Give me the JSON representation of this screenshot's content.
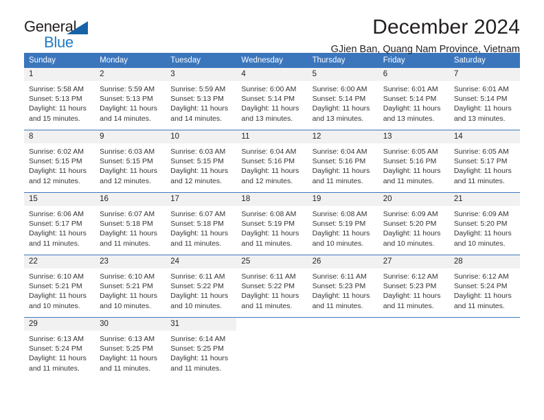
{
  "brand": {
    "name_part1": "General",
    "name_part2": "Blue",
    "triangle_icon": "blue-triangle-logo-mark"
  },
  "header": {
    "title": "December 2024",
    "subtitle": "GJien Ban, Quang Nam Province, Vietnam"
  },
  "colors": {
    "header_blue": "#3b76bd",
    "brand_blue": "#1f7ac4",
    "triangle_blue": "#1763a8",
    "daynum_band": "#f1f1f1",
    "text": "#231f20"
  },
  "calendar": {
    "weekday_headers": [
      "Sunday",
      "Monday",
      "Tuesday",
      "Wednesday",
      "Thursday",
      "Friday",
      "Saturday"
    ],
    "weeks": [
      [
        {
          "day": "1",
          "sunrise": "Sunrise: 5:58 AM",
          "sunset": "Sunset: 5:13 PM",
          "daylight": "Daylight: 11 hours and 15 minutes."
        },
        {
          "day": "2",
          "sunrise": "Sunrise: 5:59 AM",
          "sunset": "Sunset: 5:13 PM",
          "daylight": "Daylight: 11 hours and 14 minutes."
        },
        {
          "day": "3",
          "sunrise": "Sunrise: 5:59 AM",
          "sunset": "Sunset: 5:13 PM",
          "daylight": "Daylight: 11 hours and 14 minutes."
        },
        {
          "day": "4",
          "sunrise": "Sunrise: 6:00 AM",
          "sunset": "Sunset: 5:14 PM",
          "daylight": "Daylight: 11 hours and 13 minutes."
        },
        {
          "day": "5",
          "sunrise": "Sunrise: 6:00 AM",
          "sunset": "Sunset: 5:14 PM",
          "daylight": "Daylight: 11 hours and 13 minutes."
        },
        {
          "day": "6",
          "sunrise": "Sunrise: 6:01 AM",
          "sunset": "Sunset: 5:14 PM",
          "daylight": "Daylight: 11 hours and 13 minutes."
        },
        {
          "day": "7",
          "sunrise": "Sunrise: 6:01 AM",
          "sunset": "Sunset: 5:14 PM",
          "daylight": "Daylight: 11 hours and 13 minutes."
        }
      ],
      [
        {
          "day": "8",
          "sunrise": "Sunrise: 6:02 AM",
          "sunset": "Sunset: 5:15 PM",
          "daylight": "Daylight: 11 hours and 12 minutes."
        },
        {
          "day": "9",
          "sunrise": "Sunrise: 6:03 AM",
          "sunset": "Sunset: 5:15 PM",
          "daylight": "Daylight: 11 hours and 12 minutes."
        },
        {
          "day": "10",
          "sunrise": "Sunrise: 6:03 AM",
          "sunset": "Sunset: 5:15 PM",
          "daylight": "Daylight: 11 hours and 12 minutes."
        },
        {
          "day": "11",
          "sunrise": "Sunrise: 6:04 AM",
          "sunset": "Sunset: 5:16 PM",
          "daylight": "Daylight: 11 hours and 12 minutes."
        },
        {
          "day": "12",
          "sunrise": "Sunrise: 6:04 AM",
          "sunset": "Sunset: 5:16 PM",
          "daylight": "Daylight: 11 hours and 11 minutes."
        },
        {
          "day": "13",
          "sunrise": "Sunrise: 6:05 AM",
          "sunset": "Sunset: 5:16 PM",
          "daylight": "Daylight: 11 hours and 11 minutes."
        },
        {
          "day": "14",
          "sunrise": "Sunrise: 6:05 AM",
          "sunset": "Sunset: 5:17 PM",
          "daylight": "Daylight: 11 hours and 11 minutes."
        }
      ],
      [
        {
          "day": "15",
          "sunrise": "Sunrise: 6:06 AM",
          "sunset": "Sunset: 5:17 PM",
          "daylight": "Daylight: 11 hours and 11 minutes."
        },
        {
          "day": "16",
          "sunrise": "Sunrise: 6:07 AM",
          "sunset": "Sunset: 5:18 PM",
          "daylight": "Daylight: 11 hours and 11 minutes."
        },
        {
          "day": "17",
          "sunrise": "Sunrise: 6:07 AM",
          "sunset": "Sunset: 5:18 PM",
          "daylight": "Daylight: 11 hours and 11 minutes."
        },
        {
          "day": "18",
          "sunrise": "Sunrise: 6:08 AM",
          "sunset": "Sunset: 5:19 PM",
          "daylight": "Daylight: 11 hours and 11 minutes."
        },
        {
          "day": "19",
          "sunrise": "Sunrise: 6:08 AM",
          "sunset": "Sunset: 5:19 PM",
          "daylight": "Daylight: 11 hours and 10 minutes."
        },
        {
          "day": "20",
          "sunrise": "Sunrise: 6:09 AM",
          "sunset": "Sunset: 5:20 PM",
          "daylight": "Daylight: 11 hours and 10 minutes."
        },
        {
          "day": "21",
          "sunrise": "Sunrise: 6:09 AM",
          "sunset": "Sunset: 5:20 PM",
          "daylight": "Daylight: 11 hours and 10 minutes."
        }
      ],
      [
        {
          "day": "22",
          "sunrise": "Sunrise: 6:10 AM",
          "sunset": "Sunset: 5:21 PM",
          "daylight": "Daylight: 11 hours and 10 minutes."
        },
        {
          "day": "23",
          "sunrise": "Sunrise: 6:10 AM",
          "sunset": "Sunset: 5:21 PM",
          "daylight": "Daylight: 11 hours and 10 minutes."
        },
        {
          "day": "24",
          "sunrise": "Sunrise: 6:11 AM",
          "sunset": "Sunset: 5:22 PM",
          "daylight": "Daylight: 11 hours and 10 minutes."
        },
        {
          "day": "25",
          "sunrise": "Sunrise: 6:11 AM",
          "sunset": "Sunset: 5:22 PM",
          "daylight": "Daylight: 11 hours and 11 minutes."
        },
        {
          "day": "26",
          "sunrise": "Sunrise: 6:11 AM",
          "sunset": "Sunset: 5:23 PM",
          "daylight": "Daylight: 11 hours and 11 minutes."
        },
        {
          "day": "27",
          "sunrise": "Sunrise: 6:12 AM",
          "sunset": "Sunset: 5:23 PM",
          "daylight": "Daylight: 11 hours and 11 minutes."
        },
        {
          "day": "28",
          "sunrise": "Sunrise: 6:12 AM",
          "sunset": "Sunset: 5:24 PM",
          "daylight": "Daylight: 11 hours and 11 minutes."
        }
      ],
      [
        {
          "day": "29",
          "sunrise": "Sunrise: 6:13 AM",
          "sunset": "Sunset: 5:24 PM",
          "daylight": "Daylight: 11 hours and 11 minutes."
        },
        {
          "day": "30",
          "sunrise": "Sunrise: 6:13 AM",
          "sunset": "Sunset: 5:25 PM",
          "daylight": "Daylight: 11 hours and 11 minutes."
        },
        {
          "day": "31",
          "sunrise": "Sunrise: 6:14 AM",
          "sunset": "Sunset: 5:25 PM",
          "daylight": "Daylight: 11 hours and 11 minutes."
        },
        null,
        null,
        null,
        null
      ]
    ]
  }
}
